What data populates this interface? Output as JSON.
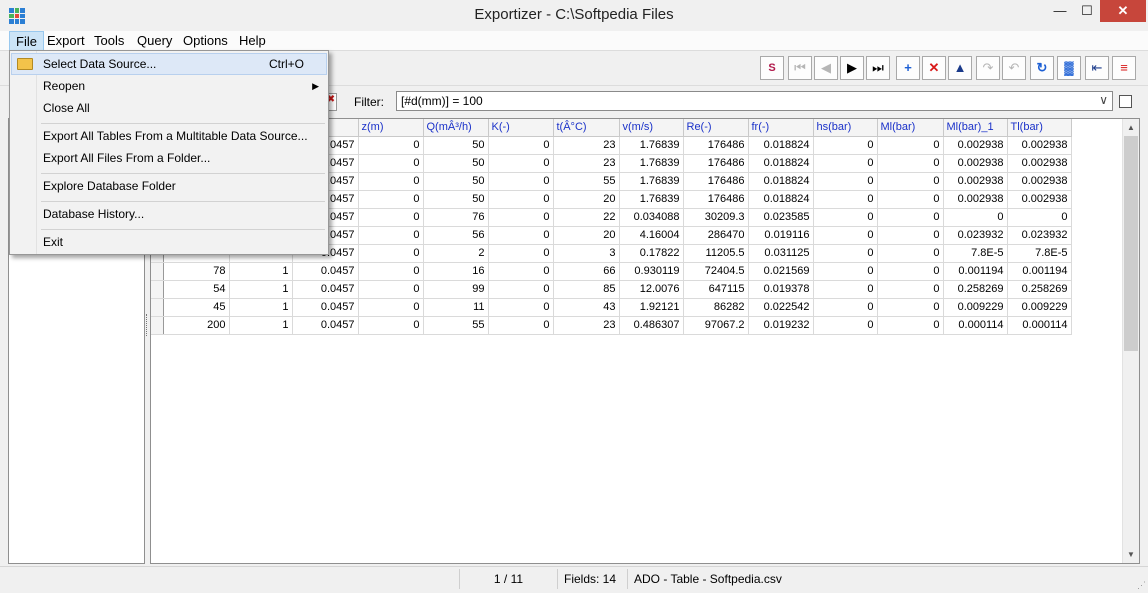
{
  "window": {
    "title": "Exportizer - C:\\Softpedia Files",
    "minimize": "—",
    "maximize": "☐",
    "close": "✕"
  },
  "menubar": [
    "File",
    "Export",
    "Tools",
    "Query",
    "Options",
    "Help"
  ],
  "file_menu": {
    "items": [
      {
        "label": "Select Data Source...",
        "shortcut": "Ctrl+O",
        "icon": "open-folder-icon"
      },
      {
        "label": "Reopen",
        "submenu": "▶"
      },
      {
        "label": "Close All"
      },
      {
        "label": "Export All Tables From a Multitable Data Source..."
      },
      {
        "label": "Export All Files From a Folder..."
      },
      {
        "label": "Explore Database Folder"
      },
      {
        "label": "Database History..."
      },
      {
        "label": "Exit"
      }
    ]
  },
  "toolbar": {
    "buttons": [
      {
        "name": "sql-query",
        "glyph": "S"
      },
      {
        "name": "first-record",
        "glyph": "⏮"
      },
      {
        "name": "prior-record",
        "glyph": "◀"
      },
      {
        "name": "next-record",
        "glyph": "▶"
      },
      {
        "name": "last-record",
        "glyph": "⏭"
      },
      {
        "name": "insert-record",
        "glyph": "+"
      },
      {
        "name": "delete-record",
        "glyph": "✕"
      },
      {
        "name": "edit-record",
        "glyph": "▲"
      },
      {
        "name": "post-edit",
        "glyph": "↷"
      },
      {
        "name": "cancel-edit",
        "glyph": "↶"
      },
      {
        "name": "refresh-data",
        "glyph": "↻"
      },
      {
        "name": "grid-view",
        "glyph": "▓"
      },
      {
        "name": "import-export",
        "glyph": "⇤"
      },
      {
        "name": "export-data",
        "glyph": "≡"
      }
    ]
  },
  "filter": {
    "label": "Filter:",
    "value": "[#d(mm)] = 100",
    "dropdown": "∨",
    "clear": "✖"
  },
  "grid": {
    "columns": [
      "z(m)",
      "Q(mÂ³/h)",
      "K(-)",
      "t(Â°C)",
      "v(m/s)",
      "Re(-)",
      "fr(-)",
      "hs(bar)",
      "Ml(bar)",
      "Ml(bar)_1",
      "Tl(bar)"
    ],
    "rows": [
      [
        "",
        "",
        "0.0457",
        "0",
        "50",
        "0",
        "23",
        "1.76839",
        "176486",
        "0.018824",
        "0",
        "0",
        "0.002938",
        "0.002938"
      ],
      [
        "",
        "",
        "0.0457",
        "0",
        "50",
        "0",
        "23",
        "1.76839",
        "176486",
        "0.018824",
        "0",
        "0",
        "0.002938",
        "0.002938"
      ],
      [
        "",
        "",
        "0.0457",
        "0",
        "50",
        "0",
        "55",
        "1.76839",
        "176486",
        "0.018824",
        "0",
        "0",
        "0.002938",
        "0.002938"
      ],
      [
        "",
        "",
        "0.0457",
        "0",
        "50",
        "0",
        "20",
        "1.76839",
        "176486",
        "0.018824",
        "0",
        "0",
        "0.002938",
        "0.002938"
      ],
      [
        "",
        "",
        "0.0457",
        "0",
        "76",
        "0",
        "22",
        "0.034088",
        "30209.3",
        "0.023585",
        "0",
        "0",
        "0",
        "0"
      ],
      [
        "",
        "",
        "0.0457",
        "0",
        "56",
        "0",
        "20",
        "4.16004",
        "286470",
        "0.019116",
        "0",
        "0",
        "0.023932",
        "0.023932"
      ],
      [
        "",
        "",
        "0.0457",
        "0",
        "2",
        "0",
        "3",
        "0.17822",
        "11205.5",
        "0.031125",
        "0",
        "0",
        "7.8E-5",
        "7.8E-5"
      ],
      [
        "78",
        "1",
        "0.0457",
        "0",
        "16",
        "0",
        "66",
        "0.930119",
        "72404.5",
        "0.021569",
        "0",
        "0",
        "0.001194",
        "0.001194"
      ],
      [
        "54",
        "1",
        "0.0457",
        "0",
        "99",
        "0",
        "85",
        "12.0076",
        "647115",
        "0.019378",
        "0",
        "0",
        "0.258269",
        "0.258269"
      ],
      [
        "45",
        "1",
        "0.0457",
        "0",
        "11",
        "0",
        "43",
        "1.92121",
        "86282",
        "0.022542",
        "0",
        "0",
        "0.009229",
        "0.009229"
      ],
      [
        "200",
        "1",
        "0.0457",
        "0",
        "55",
        "0",
        "23",
        "0.486307",
        "97067.2",
        "0.019232",
        "0",
        "0",
        "0.000114",
        "0.000114"
      ]
    ]
  },
  "scrollbar": {
    "up": "▲",
    "down": "▼"
  },
  "status": {
    "record": "1 / 11",
    "fields": "Fields: 14",
    "source": "ADO - Table - Softpedia.csv",
    "grip": "⋰"
  },
  "colors": {
    "header_text": "#1a31c9",
    "close_button": "#c7463b",
    "menu_highlight": "#cce4f7"
  }
}
